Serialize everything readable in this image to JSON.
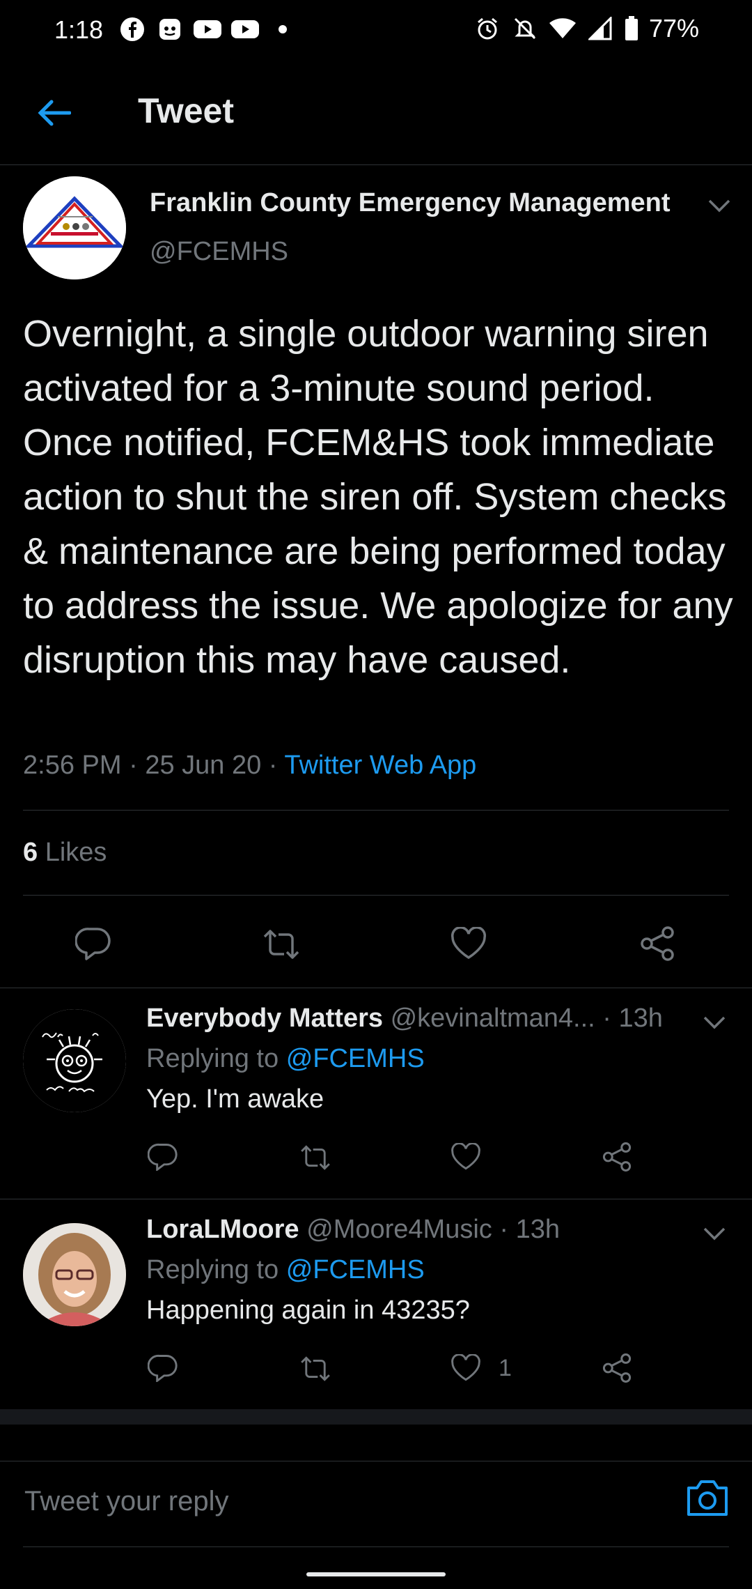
{
  "status_bar": {
    "time": "1:18",
    "battery": "77%",
    "left_icons": [
      "facebook-icon",
      "discord-icon",
      "youtube-icon",
      "youtube-icon",
      "dot-icon"
    ],
    "right_icons": [
      "alarm-icon",
      "mute-icon",
      "wifi-icon",
      "signal-icon",
      "battery-icon"
    ]
  },
  "header": {
    "title": "Tweet"
  },
  "tweet": {
    "author_name": "Franklin County Emergency Management",
    "author_handle": "@FCEMHS",
    "text": "Overnight, a single outdoor warning siren activated for a 3-minute sound period. Once notified, FCEM&HS took immediate action to shut the siren off. System checks & maintenance are being performed today to address the issue. We apologize for any disruption this may have caused.",
    "time": "2:56 PM",
    "date": "25 Jun 20",
    "separator": " · ",
    "source": "Twitter Web App",
    "likes_count": "6",
    "likes_label": "Likes"
  },
  "replies": [
    {
      "name": "Everybody Matters",
      "handle": "@kevinaltman4...",
      "age": "13h",
      "replying_label": "Replying to",
      "replying_to": "@FCEMHS",
      "text": "Yep. I'm awake",
      "likes": ""
    },
    {
      "name": "LoraLMoore",
      "handle": "@Moore4Music",
      "age": "13h",
      "replying_label": "Replying to",
      "replying_to": "@FCEMHS",
      "text": "Happening again in 43235?",
      "likes": "1"
    }
  ],
  "composer": {
    "placeholder": "Tweet your reply"
  },
  "colors": {
    "accent": "#1d9bf0",
    "background": "#000000",
    "secondary_text": "#71767b"
  }
}
